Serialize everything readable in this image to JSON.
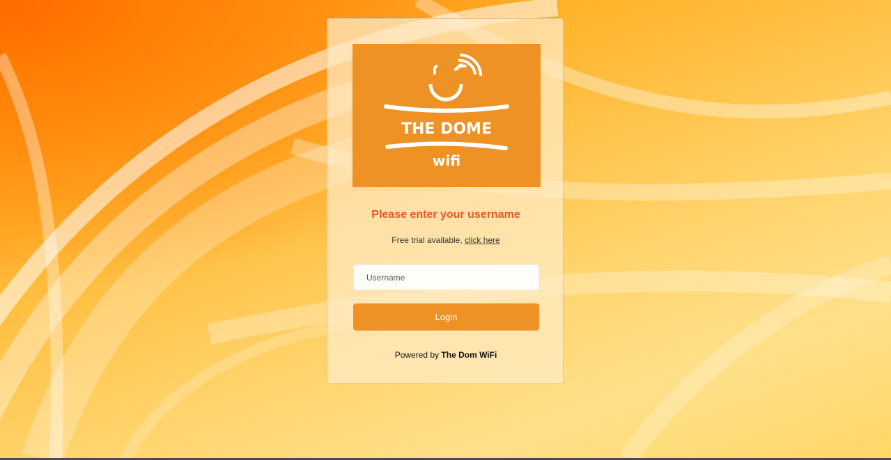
{
  "logo": {
    "brand_line": "THE DOME",
    "sub_line": "wifi"
  },
  "login_card": {
    "heading": "Please enter your username",
    "trial_text": "Free trial available, ",
    "trial_link": "click here",
    "username_placeholder": "Username",
    "login_button": "Login",
    "powered_prefix": "Powered by ",
    "powered_brand": "The Dom WiFi"
  },
  "colors": {
    "accent": "#ee9225",
    "heading": "#e8562a"
  },
  "icons": {
    "logo_mark": "smile-wifi-icon"
  }
}
